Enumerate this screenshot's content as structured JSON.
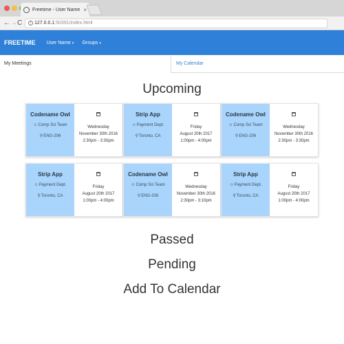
{
  "browser": {
    "tab_title": "Freetime - User Name",
    "tab_close": "×",
    "url_host": "127.0.0.1",
    "url_rest": ":50391/index.html",
    "back": "←",
    "forward": "→",
    "reload": "C",
    "info": "i",
    "star": "☆",
    "menu": "⋮"
  },
  "navbar": {
    "brand": "FREETIME",
    "items": [
      {
        "label": "User Name",
        "caret": "▾"
      },
      {
        "label": "Groups",
        "caret": "▾"
      }
    ],
    "color": "#2f80d8"
  },
  "subtabs": {
    "active": "My Meetings",
    "inactive": "My Calendar"
  },
  "upcoming": {
    "heading": "Upcoming",
    "cards": [
      {
        "title": "Codename Owl",
        "team": "Comp Sci Team",
        "location": "ENG-206",
        "day": "Wednesday",
        "date": "November 30th 2016",
        "time": "2:30pm - 3:30pm"
      },
      {
        "title": "Strip App",
        "team": "Payment Dept.",
        "location": "Toronto, CA",
        "day": "Friday",
        "date": "August 20th 2017",
        "time": "1:00pm - 4:00pm"
      },
      {
        "title": "Codename Owl",
        "team": "Comp Sci Team",
        "location": "ENG-206",
        "day": "Wednesday",
        "date": "November 30th 2016",
        "time": "2:30pm - 3:30pm"
      },
      {
        "title": "Strip App",
        "team": "Payment Dept.",
        "location": "Toronto, CA",
        "day": "Friday",
        "date": "August 20th 2017",
        "time": "1:00pm - 4:00pm"
      },
      {
        "title": "Codename Owl",
        "team": "Comp Sci Team",
        "location": "ENG-206",
        "day": "Wednesday",
        "date": "November 30th 2016",
        "time": "2:30pm - 3:10pm"
      },
      {
        "title": "Strip App",
        "team": "Payment Dept.",
        "location": "Toronto, CA",
        "day": "Friday",
        "date": "August 20th 2017",
        "time": "1:00pm - 4:00pm"
      }
    ],
    "card_accent": "#a9d4fb"
  },
  "sections": {
    "passed": "Passed",
    "pending": "Pending",
    "add_to_calendar": "Add To Calendar"
  },
  "icons": {
    "team": "group-icon",
    "location": "map-marker-icon",
    "calendar": "calendar-icon"
  }
}
